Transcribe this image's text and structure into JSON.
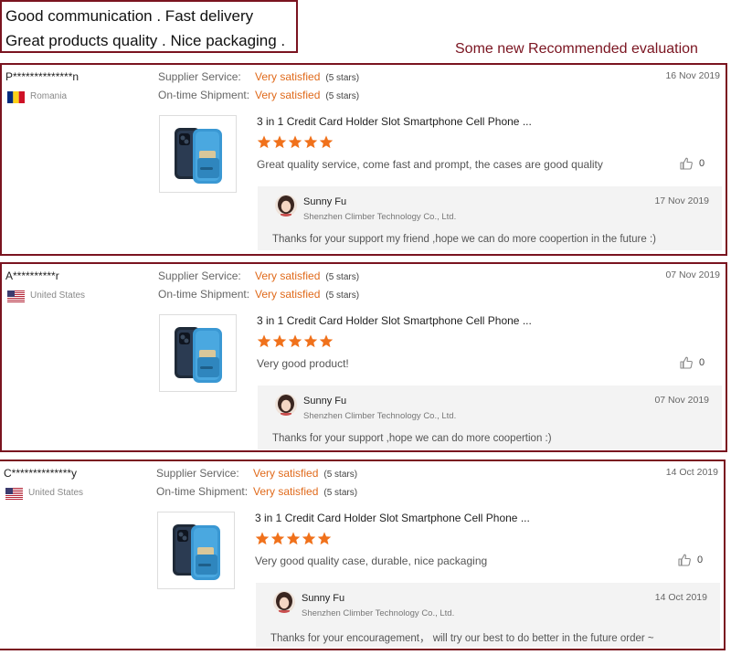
{
  "banner": {
    "line1": "Good communication . Fast delivery",
    "line2": "Great products quality . Nice packaging ."
  },
  "recommended_label": "Some new Recommended evaluation",
  "labels": {
    "supplier_service": "Supplier Service:",
    "ontime_shipment": "On-time Shipment:"
  },
  "colors": {
    "accent_orange": "#f0711b",
    "frame_red": "#7a1420"
  },
  "reviews": [
    {
      "user": "P**************n",
      "country": "Romania",
      "flag": "romania-flag",
      "supplier_value": "Very satisfied",
      "supplier_stars": "(5 stars)",
      "shipment_value": "Very satisfied",
      "shipment_stars": "(5 stars)",
      "date": "16 Nov 2019",
      "product_title": "3 in 1 Credit Card Holder Slot Smartphone Cell Phone ...",
      "rating": 5,
      "comment": "Great quality service, come fast and prompt, the cases are good quality",
      "likes": "0",
      "reply": {
        "name": "Sunny Fu",
        "company": "Shenzhen Climber Technology Co., Ltd.",
        "date": "17 Nov 2019",
        "text": "Thanks for your support my friend ,hope we can do more coopertion  in the future :)"
      }
    },
    {
      "user": "A**********r",
      "country": "United States",
      "flag": "us-flag",
      "supplier_value": "Very satisfied",
      "supplier_stars": "(5 stars)",
      "shipment_value": "Very satisfied",
      "shipment_stars": "(5 stars)",
      "date": "07 Nov 2019",
      "product_title": "3 in 1 Credit Card Holder Slot Smartphone Cell Phone ...",
      "rating": 5,
      "comment": "Very good product!",
      "likes": "0",
      "reply": {
        "name": "Sunny Fu",
        "company": "Shenzhen Climber Technology Co., Ltd.",
        "date": "07 Nov 2019",
        "text": "Thanks for your support ,hope we can do more coopertion :)"
      }
    },
    {
      "user": "C**************y",
      "country": "United States",
      "flag": "us-flag",
      "supplier_value": "Very satisfied",
      "supplier_stars": "(5 stars)",
      "shipment_value": "Very satisfied",
      "shipment_stars": "(5 stars)",
      "date": "14 Oct 2019",
      "product_title": "3 in 1 Credit Card Holder Slot Smartphone Cell Phone ...",
      "rating": 5,
      "comment": "Very good quality case, durable, nice packaging",
      "likes": "0",
      "reply": {
        "name": "Sunny Fu",
        "company": "Shenzhen Climber Technology Co., Ltd.",
        "date": "14 Oct 2019",
        "text": "Thanks for your encouragement， will try our best to do better in the future order ~"
      }
    }
  ]
}
